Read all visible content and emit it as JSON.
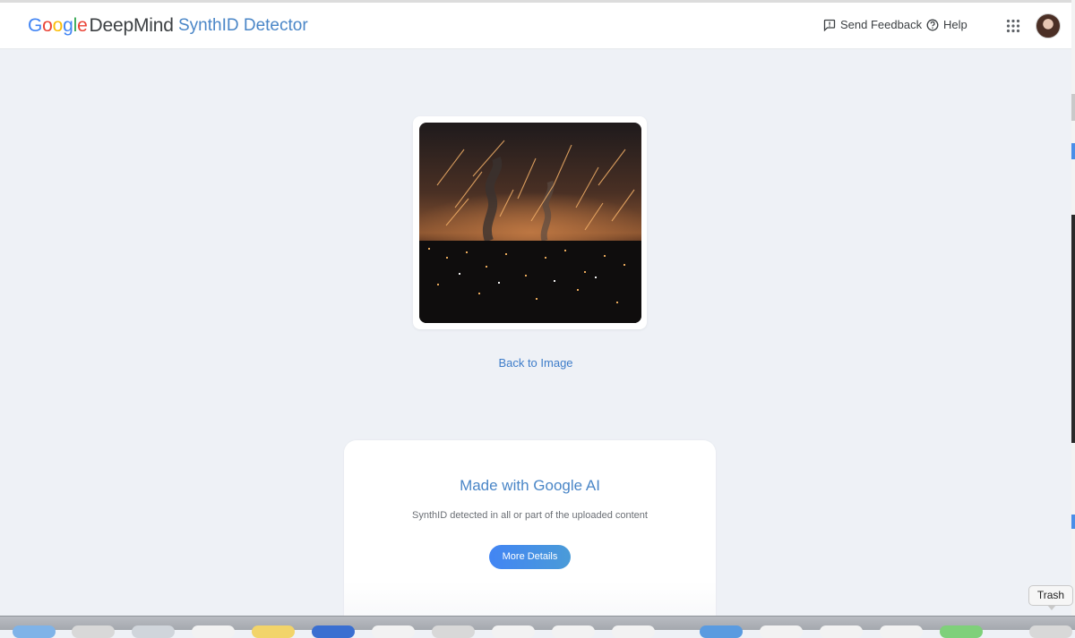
{
  "header": {
    "logo_google_letters": [
      {
        "char": "G",
        "color": "#4285f4"
      },
      {
        "char": "o",
        "color": "#ea4335"
      },
      {
        "char": "o",
        "color": "#fbbc05"
      },
      {
        "char": "g",
        "color": "#4285f4"
      },
      {
        "char": "l",
        "color": "#34a853"
      },
      {
        "char": "e",
        "color": "#ea4335"
      }
    ],
    "logo_suffix": "DeepMind",
    "product_name": "SynthID Detector",
    "feedback_label": "Send Feedback",
    "feedback_icon": "feedback-icon",
    "help_label": "Help",
    "help_icon": "help-circle-icon",
    "apps_icon": "apps-grid-icon",
    "avatar_icon": "user-avatar"
  },
  "main": {
    "uploaded_image_desc_icon": "night-city-image",
    "back_link": "Back to Image"
  },
  "result": {
    "title": "Made with Google AI",
    "subtitle": "SynthID detected in all or part of the uploaded content",
    "button_label": "More Details"
  },
  "dock": {
    "tooltip": "Trash",
    "icon_colors": [
      "#7fb3e8",
      "#d8d8d8",
      "#d0d5db",
      "#f2f2f2",
      "#f2d46a",
      "#3a6fd1",
      "#f2f2f2",
      "#d8d8d8",
      "#f2f2f2",
      "#f2f2f2",
      "#f2f2f2",
      "#5a9be0",
      "#f2f2f2",
      "#f2f2f2",
      "#f2f2f2",
      "#7fd07a",
      "#d8d8d8"
    ]
  },
  "colors": {
    "accent": "#4a86c7",
    "link": "#3d7cc9",
    "background": "#eef1f6"
  }
}
